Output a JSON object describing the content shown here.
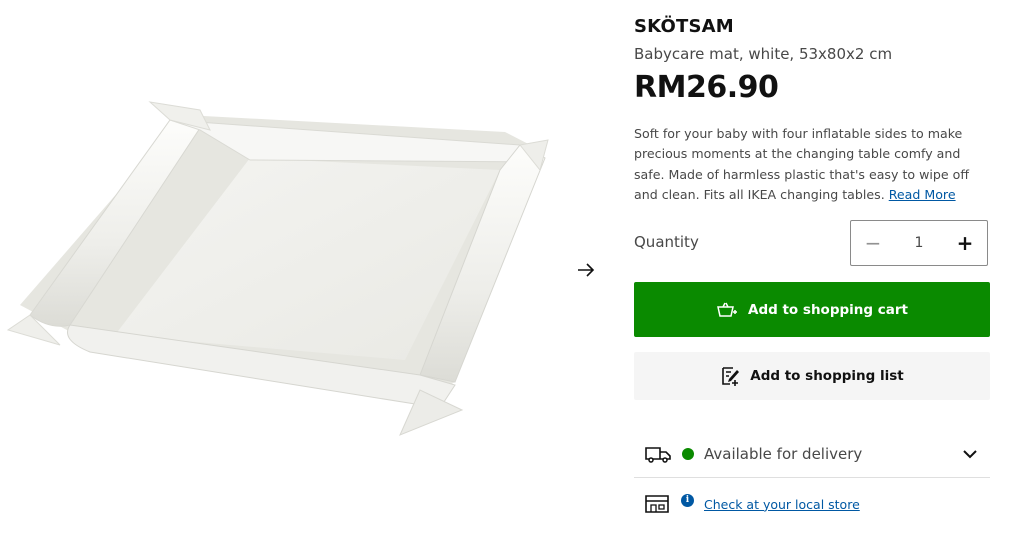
{
  "product": {
    "name": "SKÖTSAM",
    "description": "Babycare mat, white, 53x80x2 cm",
    "price": "RM26.90",
    "summary": "Soft for your baby with four inflatable sides to make precious moments at the changing table comfy and safe. Made of harmless plastic that's easy to wipe off and clean. Fits all IKEA changing tables. ",
    "read_more": "Read More"
  },
  "quantity": {
    "label": "Quantity",
    "value": "1",
    "minus": "−",
    "plus": "+"
  },
  "buttons": {
    "add_to_cart": "Add to shopping cart",
    "add_to_list": "Add to shopping list"
  },
  "availability": {
    "delivery_text": "Available for delivery",
    "store_link": "Check at your local store",
    "info_glyph": "i"
  },
  "icons": {
    "next": "arrow-right-icon",
    "cart": "shopping-cart-icon",
    "list": "shopping-list-icon",
    "truck": "truck-icon",
    "store": "store-icon",
    "chevron": "chevron-down-icon",
    "info": "info-icon"
  },
  "colors": {
    "primary_green": "#0a8a00",
    "link_blue": "#0058a3",
    "secondary_button": "#f5f5f5"
  }
}
